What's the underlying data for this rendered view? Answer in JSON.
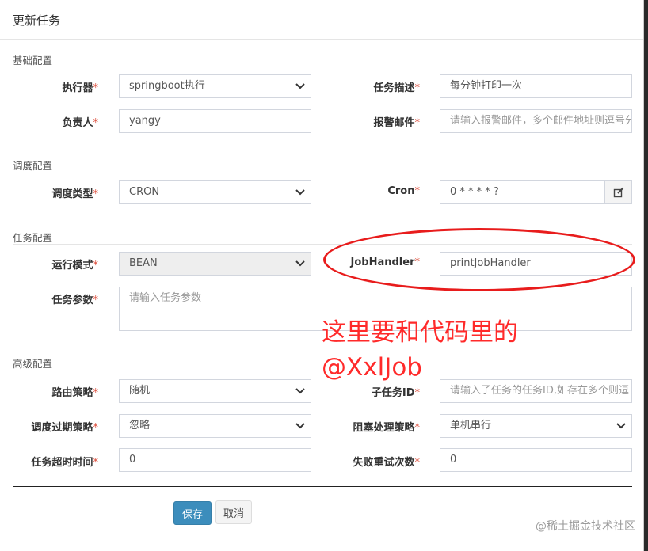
{
  "dialog": {
    "title": "更新任务"
  },
  "sections": {
    "basic": "基础配置",
    "schedule": "调度配置",
    "task": "任务配置",
    "advanced": "高级配置"
  },
  "fields": {
    "executor": {
      "label": "执行器",
      "value": "springboot执行"
    },
    "job_desc": {
      "label": "任务描述",
      "value": "每分钟打印一次"
    },
    "author": {
      "label": "负责人",
      "value": "yangy"
    },
    "alarm_email": {
      "label": "报警邮件",
      "placeholder": "请输入报警邮件，多个邮件地址则逗号分"
    },
    "schedule_type": {
      "label": "调度类型",
      "value": "CRON"
    },
    "cron": {
      "label": "Cron",
      "value": "0 * * * * ?"
    },
    "run_mode": {
      "label": "运行模式",
      "value": "BEAN"
    },
    "job_handler": {
      "label": "JobHandler",
      "value": "printJobHandler"
    },
    "job_param": {
      "label": "任务参数",
      "placeholder": "请输入任务参数"
    },
    "route_strategy": {
      "label": "路由策略",
      "value": "随机"
    },
    "child_job_id": {
      "label": "子任务ID",
      "placeholder": "请输入子任务的任务ID,如存在多个则逗"
    },
    "misfire_strategy": {
      "label": "调度过期策略",
      "value": "忽略"
    },
    "block_strategy": {
      "label": "阻塞处理策略",
      "value": "单机串行"
    },
    "timeout": {
      "label": "任务超时时间",
      "value": "0"
    },
    "retry_count": {
      "label": "失败重试次数",
      "value": "0"
    }
  },
  "buttons": {
    "save": "保存",
    "cancel": "取消"
  },
  "annotation": {
    "line1": "这里要和代码里的",
    "line2": "@XxlJob"
  },
  "watermark": "@稀土掘金技术社区",
  "required_mark": "*",
  "colors": {
    "primary": "#3c8dbc",
    "required": "#dd4b39",
    "annotation": "#ff2a2a"
  }
}
